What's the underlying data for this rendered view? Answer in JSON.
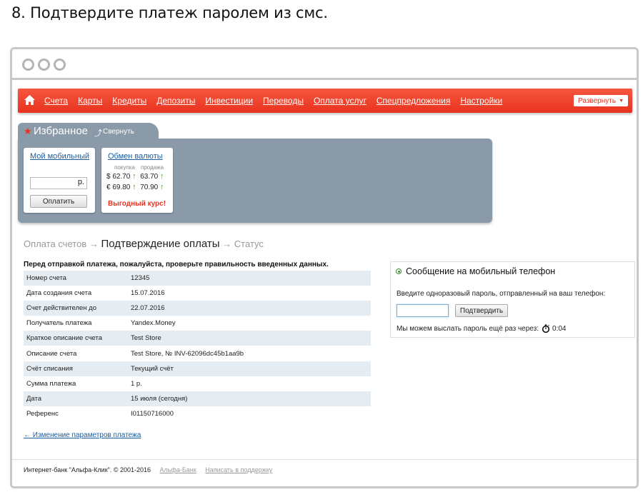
{
  "step_title": "8. Подтвердите платеж паролем из смс.",
  "nav": {
    "items": [
      "Счета",
      "Карты",
      "Кредиты",
      "Депозиты",
      "Инвестиции",
      "Переводы",
      "Оплата услуг",
      "Спецпредложения",
      "Настройки"
    ],
    "expand_label": "Развернуть"
  },
  "favorites": {
    "title": "Избранное",
    "collapse_label": "Свернуть",
    "mobile": {
      "title": "Мой мобильный",
      "amount_value": "р.",
      "pay_label": "Оплатить"
    },
    "exchange": {
      "title": "Обмен валюты",
      "buy_label": "покупка",
      "sell_label": "продажа",
      "rows": [
        {
          "symbol": "$",
          "buy": "62.70",
          "sell": "63.70"
        },
        {
          "symbol": "€",
          "buy": "69.80",
          "sell": "70.90"
        }
      ],
      "promo": "Выгодный курс!"
    }
  },
  "breadcrumb": {
    "step1": "Оплата счетов",
    "arrow": "→",
    "current": "Подтверждение оплаты",
    "step3": "Статус"
  },
  "notice": "Перед отправкой платежа, пожалуйста, проверьте правильность введенных данных.",
  "details": [
    {
      "label": "Номер счета",
      "value": "12345"
    },
    {
      "label": "Дата создания счета",
      "value": "15.07.2016"
    },
    {
      "label": "Счет действителен до",
      "value": "22.07.2016"
    },
    {
      "label": "Получатель платежа",
      "value": "Yandex.Money"
    },
    {
      "label": "Краткое описание счета",
      "value": "Test Store"
    },
    {
      "label": "Описание счета",
      "value": "Test Store, № INV-62096dc45b1aa9b"
    },
    {
      "label": "Счёт списания",
      "value": "Текущий счёт"
    },
    {
      "label": "Сумма платежа",
      "value": "1 р."
    },
    {
      "label": "Дата",
      "value": "15 июля (сегодня)"
    },
    {
      "label": "Референс",
      "value": "I01150716000"
    }
  ],
  "back_link": "← Изменение параметров платежа",
  "sms": {
    "title": "Сообщение на мобильный телефон",
    "prompt": "Введите одноразовый пароль, отправленный на ваш телефон:",
    "code_value": "",
    "confirm_label": "Подтвердить",
    "resend_text": "Мы можем выслать пароль ещё раз через:",
    "timer": "0:04"
  },
  "footer": {
    "copyright": "Интернет-банк \"Альфа-Клик\". © 2001-2016",
    "bank_link": "Альфа-Банк",
    "support_link": "Написать в поддержку"
  },
  "colors": {
    "brand_red": "#e8321f",
    "panel_gray": "#8a9aa9",
    "link_blue": "#1a5c9e",
    "up_green": "#49a02a"
  }
}
